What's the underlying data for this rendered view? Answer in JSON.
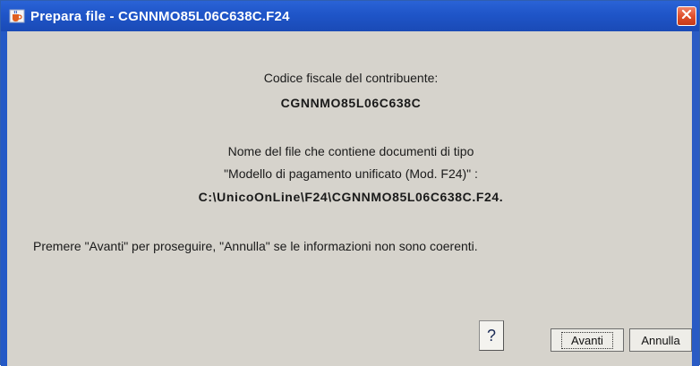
{
  "window": {
    "title": "Prepara file - CGNNMO85L06C638C.F24",
    "close_icon": "close-icon",
    "app_icon": "java-cup-icon"
  },
  "dialog": {
    "codice_label": "Codice fiscale del contribuente:",
    "codice_value": "CGNNMO85L06C638C",
    "file_line1": "Nome del file che contiene documenti di tipo",
    "file_line2": "\"Modello di pagamento unificato (Mod. F24)\" :",
    "file_path": "C:\\UnicoOnLine\\F24\\CGNNMO85L06C638C.F24.",
    "instructions": "Premere \"Avanti\" per proseguire, \"Annulla\" se le informazioni non sono coerenti."
  },
  "buttons": {
    "help_label": "?",
    "avanti_label": "Avanti",
    "annulla_label": "Annulla"
  },
  "colors": {
    "titlebar": "#1f55c8",
    "close": "#e0502c",
    "panel": "#d6d3cc"
  }
}
